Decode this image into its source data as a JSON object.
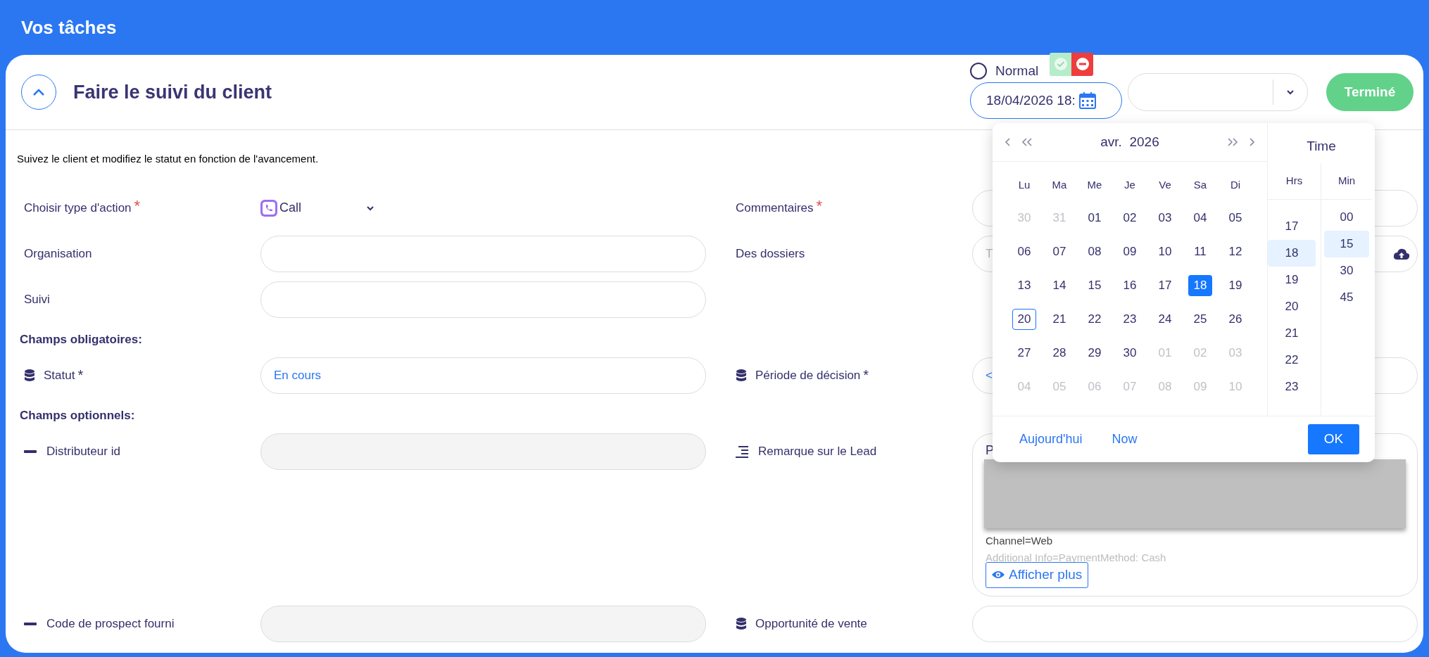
{
  "header": {
    "title": "Vos tâches"
  },
  "task": {
    "title": "Faire le suivi du client",
    "expanded": true,
    "priority": {
      "label": "Normal",
      "selected": false
    },
    "due_date": "18/04/2026 18:",
    "done_button": "Terminé"
  },
  "description": "Suivez le client et modifiez le statut en fonction de l'avancement.",
  "rows": [
    {
      "left": {
        "kind": "select",
        "label": "Choisir type d'action",
        "required": "*",
        "value": "Call"
      },
      "right": {
        "kind": "input",
        "label": "Commentaires",
        "required": "*"
      }
    },
    {
      "left": {
        "kind": "input",
        "label": "Organisation"
      },
      "right": {
        "kind": "upload",
        "label": "Des dossiers",
        "placeholder": "T"
      }
    },
    {
      "left": {
        "kind": "input",
        "label": "Suivi"
      }
    },
    {
      "left": {
        "kind": "heading",
        "label": "Champs obligatoires:"
      }
    },
    {
      "left": {
        "kind": "lookup",
        "label": "Statut",
        "required": "*",
        "value": "En cours"
      },
      "right": {
        "kind": "lookup",
        "label": "Période de décision",
        "required": "*",
        "value": "<"
      }
    },
    {
      "left": {
        "kind": "heading",
        "label": "Champs optionnels:"
      }
    },
    {
      "left": {
        "kind": "plain",
        "label": "Distributeur id",
        "disabled": true
      },
      "right": {
        "kind": "note",
        "label": "Remarque sur le Lead",
        "text": "P",
        "lines": [
          {
            "text": "Channel=Web",
            "faded": false
          },
          {
            "text": "Additional Info=PaymentMethod: Cash",
            "faded": true
          }
        ],
        "button": "Afficher plus"
      }
    },
    {
      "left": {
        "kind": "plain",
        "label": "Code de prospect fourni",
        "disabled": true
      },
      "right": {
        "kind": "lookup",
        "label": "Opportunité de vente"
      }
    }
  ],
  "calendar": {
    "month": "avr.  2026",
    "weekdays": [
      "Lu",
      "Ma",
      "Me",
      "Je",
      "Ve",
      "Sa",
      "Di"
    ],
    "weeks": [
      [
        {
          "day": "30",
          "muted": true,
          "selected": false,
          "today": false
        },
        {
          "day": "31",
          "muted": true,
          "selected": false,
          "today": false
        },
        {
          "day": "01",
          "muted": false,
          "selected": false,
          "today": false
        },
        {
          "day": "02",
          "muted": false,
          "selected": false,
          "today": false
        },
        {
          "day": "03",
          "muted": false,
          "selected": false,
          "today": false
        },
        {
          "day": "04",
          "muted": false,
          "selected": false,
          "today": false
        },
        {
          "day": "05",
          "muted": false,
          "selected": false,
          "today": false
        }
      ],
      [
        {
          "day": "06",
          "muted": false,
          "selected": false,
          "today": false
        },
        {
          "day": "07",
          "muted": false,
          "selected": false,
          "today": false
        },
        {
          "day": "08",
          "muted": false,
          "selected": false,
          "today": false
        },
        {
          "day": "09",
          "muted": false,
          "selected": false,
          "today": false
        },
        {
          "day": "10",
          "muted": false,
          "selected": false,
          "today": false
        },
        {
          "day": "11",
          "muted": false,
          "selected": false,
          "today": false
        },
        {
          "day": "12",
          "muted": false,
          "selected": false,
          "today": false
        }
      ],
      [
        {
          "day": "13",
          "muted": false,
          "selected": false,
          "today": false
        },
        {
          "day": "14",
          "muted": false,
          "selected": false,
          "today": false
        },
        {
          "day": "15",
          "muted": false,
          "selected": false,
          "today": false
        },
        {
          "day": "16",
          "muted": false,
          "selected": false,
          "today": false
        },
        {
          "day": "17",
          "muted": false,
          "selected": false,
          "today": false
        },
        {
          "day": "18",
          "muted": false,
          "selected": true,
          "today": false
        },
        {
          "day": "19",
          "muted": false,
          "selected": false,
          "today": false
        }
      ],
      [
        {
          "day": "20",
          "muted": false,
          "selected": false,
          "today": true
        },
        {
          "day": "21",
          "muted": false,
          "selected": false,
          "today": false
        },
        {
          "day": "22",
          "muted": false,
          "selected": false,
          "today": false
        },
        {
          "day": "23",
          "muted": false,
          "selected": false,
          "today": false
        },
        {
          "day": "24",
          "muted": false,
          "selected": false,
          "today": false
        },
        {
          "day": "25",
          "muted": false,
          "selected": false,
          "today": false
        },
        {
          "day": "26",
          "muted": false,
          "selected": false,
          "today": false
        }
      ],
      [
        {
          "day": "27",
          "muted": false,
          "selected": false,
          "today": false
        },
        {
          "day": "28",
          "muted": false,
          "selected": false,
          "today": false
        },
        {
          "day": "29",
          "muted": false,
          "selected": false,
          "today": false
        },
        {
          "day": "30",
          "muted": false,
          "selected": false,
          "today": false
        },
        {
          "day": "01",
          "muted": true,
          "selected": false,
          "today": false
        },
        {
          "day": "02",
          "muted": true,
          "selected": false,
          "today": false
        },
        {
          "day": "03",
          "muted": true,
          "selected": false,
          "today": false
        }
      ],
      [
        {
          "day": "04",
          "muted": true,
          "selected": false,
          "today": false
        },
        {
          "day": "05",
          "muted": true,
          "selected": false,
          "today": false
        },
        {
          "day": "06",
          "muted": true,
          "selected": false,
          "today": false
        },
        {
          "day": "07",
          "muted": true,
          "selected": false,
          "today": false
        },
        {
          "day": "08",
          "muted": true,
          "selected": false,
          "today": false
        },
        {
          "day": "09",
          "muted": true,
          "selected": false,
          "today": false
        },
        {
          "day": "10",
          "muted": true,
          "selected": false,
          "today": false
        }
      ]
    ],
    "time_label": "Time",
    "hours_label": "Hrs",
    "minutes_label": "Min",
    "hours": [
      {
        "label": "17",
        "selected": false
      },
      {
        "label": "18",
        "selected": true
      },
      {
        "label": "19",
        "selected": false
      },
      {
        "label": "20",
        "selected": false
      },
      {
        "label": "21",
        "selected": false
      },
      {
        "label": "22",
        "selected": false
      },
      {
        "label": "23",
        "selected": false
      }
    ],
    "minutes": [
      {
        "label": "00",
        "selected": false
      },
      {
        "label": "15",
        "selected": true
      },
      {
        "label": "30",
        "selected": false
      },
      {
        "label": "45",
        "selected": false
      }
    ],
    "today_link": "Aujourd'hui",
    "now_link": "Now",
    "ok_button": "OK"
  }
}
